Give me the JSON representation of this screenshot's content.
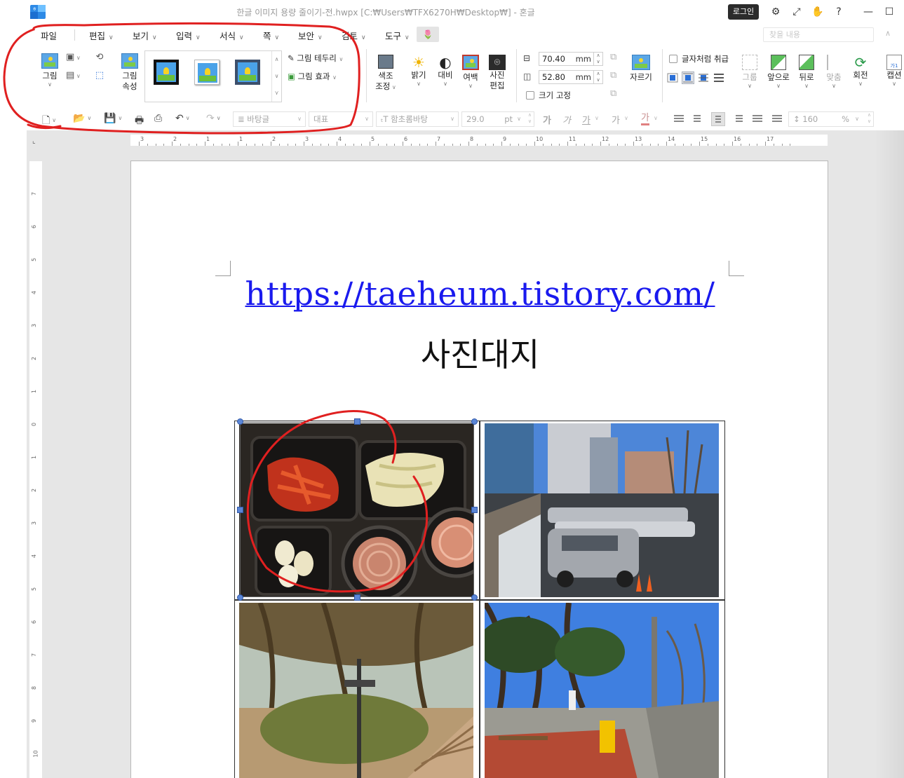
{
  "titlebar": {
    "title": "한글 이미지 용량 줄이기-전.hwpx [C:₩Users₩TFX6270H₩Desktop₩] - 혼글",
    "login_label": "로그인"
  },
  "menu": {
    "items": [
      {
        "label": "파일"
      },
      {
        "label": "편집"
      },
      {
        "label": "보기"
      },
      {
        "label": "입력"
      },
      {
        "label": "서식"
      },
      {
        "label": "쪽"
      },
      {
        "label": "보안"
      },
      {
        "label": "검토"
      },
      {
        "label": "도구"
      }
    ],
    "find_placeholder": "찾을 내용"
  },
  "ribbon": {
    "picture_label": "그림",
    "picture_props_label": "그림 속성",
    "picture_props_line1": "그림",
    "picture_props_line2": "속성",
    "border_label": "그림 테두리",
    "effect_label": "그림 효과",
    "color_adjust_line1": "색조",
    "color_adjust_line2": "조정",
    "brightness_label": "밝기",
    "contrast_label": "대비",
    "margin_label": "여백",
    "photo_edit_line1": "사진",
    "photo_edit_line2": "편집",
    "width_value": "70.40",
    "height_value": "52.80",
    "unit": "mm",
    "fix_size_label": "크기 고정",
    "crop_label": "자르기",
    "treat_as_char_label": "글자처럼 취급",
    "group_label": "그룹",
    "front_label": "앞으로",
    "back_label": "뒤로",
    "align_label": "맞춤",
    "rotate_label": "회전",
    "caption_label": "캡션"
  },
  "toolbar2": {
    "style_value": "바탕글",
    "lang_value": "대표",
    "font_value": "함초롬바탕",
    "size_value": "29.0",
    "size_unit": "pt",
    "bold": "가",
    "italic": "가",
    "underline": "가",
    "strike": "가",
    "color": "가",
    "line_spacing_value": "160",
    "line_spacing_unit": "%"
  },
  "ruler": {
    "h_numbers": [
      "3",
      "2",
      "1",
      "1",
      "2",
      "3",
      "4",
      "5",
      "6",
      "7",
      "8",
      "9",
      "10",
      "11",
      "12",
      "13",
      "14",
      "15",
      "16",
      "17"
    ],
    "v_numbers": [
      "7",
      "6",
      "5",
      "4",
      "3",
      "2",
      "1",
      "0",
      "1",
      "2",
      "3",
      "4",
      "5",
      "6",
      "7",
      "8",
      "9",
      "10"
    ]
  },
  "document": {
    "link_text": "https://taeheum.tistory.com/",
    "title_text": "사진대지"
  },
  "photos": [
    {
      "name": "food-photo"
    },
    {
      "name": "parking-lot-photo"
    },
    {
      "name": "forest-path-photo"
    },
    {
      "name": "street-photo"
    }
  ],
  "colors": {
    "accent_blue": "#1a1aee",
    "annotation_red": "#e02020",
    "handle_blue": "#5b86d6"
  }
}
